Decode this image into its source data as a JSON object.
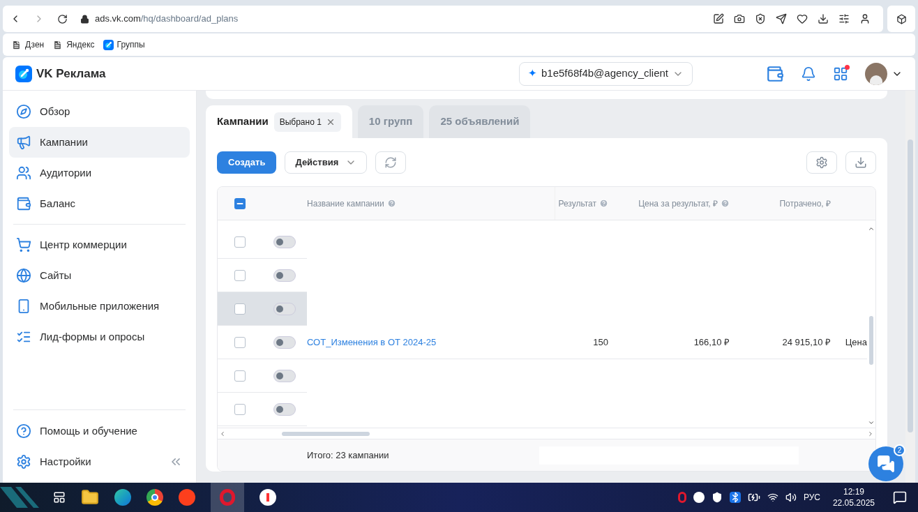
{
  "browser": {
    "url_host": "ads.vk.com",
    "url_path": "/hq/dashboard/ad_plans",
    "bookmarks": [
      {
        "label": "Дзен",
        "kind": "page"
      },
      {
        "label": "Яндекс",
        "kind": "page"
      },
      {
        "label": "Группы",
        "kind": "vk"
      }
    ]
  },
  "header": {
    "brand": "VK Реклама",
    "account_mark": "✦",
    "account": "b1e5f68f4b@agency_client",
    "apps_notification": true
  },
  "sidebar": {
    "items": [
      {
        "label": "Обзор",
        "selected": false
      },
      {
        "label": "Кампании",
        "selected": true
      },
      {
        "label": "Аудитории",
        "selected": false
      },
      {
        "label": "Баланс",
        "selected": false
      },
      {
        "label": "Центр коммерции",
        "selected": false
      },
      {
        "label": "Сайты",
        "selected": false
      },
      {
        "label": "Мобильные приложения",
        "selected": false
      },
      {
        "label": "Лид-формы и опросы",
        "selected": false
      }
    ],
    "bottom": [
      {
        "label": "Помощь и обучение"
      },
      {
        "label": "Настройки"
      }
    ]
  },
  "tabs": [
    {
      "label": "Кампании",
      "badge": "Выбрано 1",
      "selected": true
    },
    {
      "label": "10 групп",
      "selected": false
    },
    {
      "label": "25 объявлений",
      "selected": false
    }
  ],
  "toolbar": {
    "create": "Создать",
    "actions": "Действия"
  },
  "table": {
    "select_all_indeterminate": true,
    "columns": [
      "Название кампании",
      "Результат",
      "Цена за результат, ₽",
      "Потрачено, ₽"
    ],
    "column_help": [
      true,
      true,
      true,
      false
    ],
    "rows": [
      {
        "checked": false,
        "on": false,
        "highlighted": false
      },
      {
        "checked": false,
        "on": false,
        "highlighted": false
      },
      {
        "checked": false,
        "on": false,
        "highlighted": true
      },
      {
        "checked": false,
        "on": false,
        "highlighted": false,
        "name": "СОТ_Изменения в ОТ 2024-25",
        "result": "150",
        "price": "166,10 ₽",
        "spent": "24 915,10 ₽",
        "column_5": "Цена"
      },
      {
        "checked": false,
        "on": false,
        "highlighted": false
      },
      {
        "checked": false,
        "on": false,
        "highlighted": false
      }
    ],
    "total": "Итого: 23 кампании"
  },
  "chat": {
    "badge": "2"
  },
  "taskbar": {
    "language": "РУС",
    "time": "12:19",
    "date": "22.05.2025"
  }
}
